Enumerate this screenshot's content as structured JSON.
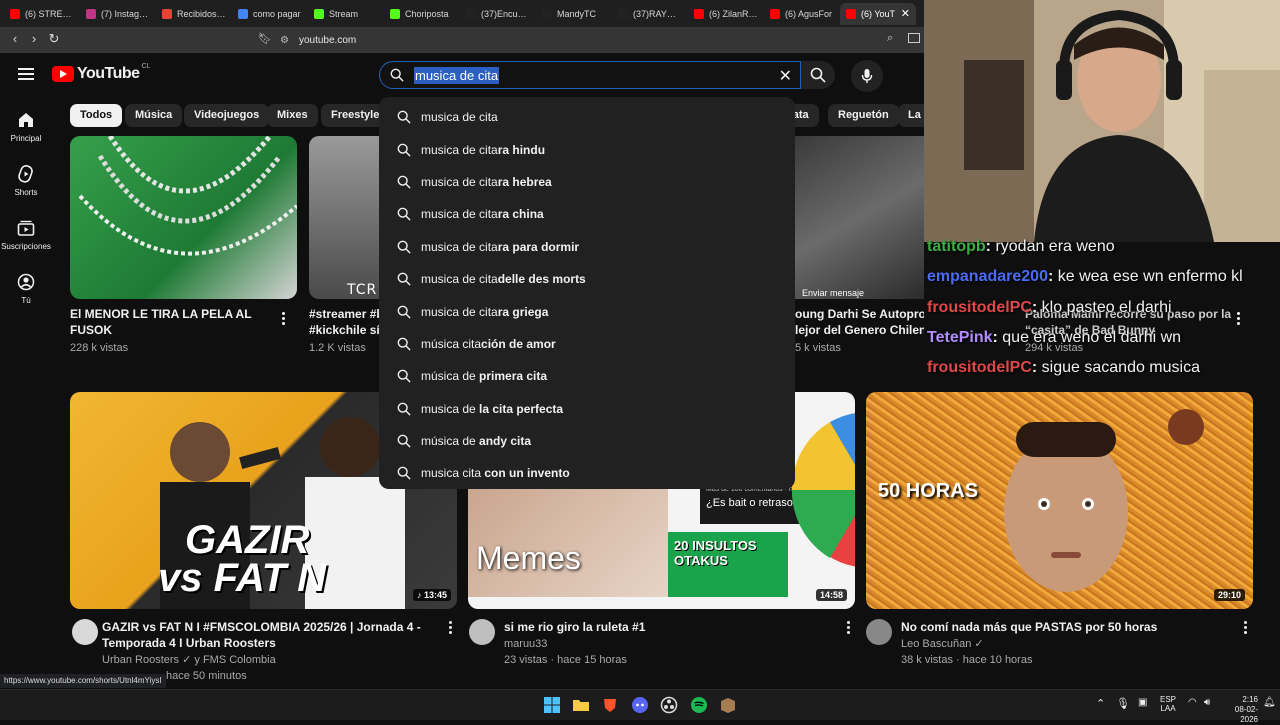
{
  "browser": {
    "tabs": [
      {
        "label": "(6) STREAM",
        "color": "#ff0000"
      },
      {
        "label": "(7) Instagram",
        "color": "#c13584"
      },
      {
        "label": "Recibidos (1",
        "color": "#ea4335"
      },
      {
        "label": "como pagar",
        "color": "#4285f4"
      },
      {
        "label": "Stream",
        "color": "#53fc18"
      },
      {
        "label": "Choriposta",
        "color": "#53fc18"
      },
      {
        "label": "(37)Encuent",
        "color": "#222222"
      },
      {
        "label": "MandyTC",
        "color": "#222222"
      },
      {
        "label": "(37)RAYMAN",
        "color": "#222222"
      },
      {
        "label": "(6) ZilanRap",
        "color": "#ff0000"
      },
      {
        "label": "(6) AgusFor",
        "color": "#ff0000"
      },
      {
        "label": "(6) YouT",
        "color": "#ff0000",
        "active": true
      }
    ],
    "tab_close": "✕",
    "url": "youtube.com"
  },
  "header": {
    "logo_text": "YouTube",
    "country_code": "CL",
    "search_query": "musica de cita"
  },
  "sidebar": {
    "items": [
      {
        "label": "Principal",
        "icon": "home-icon"
      },
      {
        "label": "Shorts",
        "icon": "shorts-icon"
      },
      {
        "label": "Suscripciones",
        "icon": "subscriptions-icon"
      },
      {
        "label": "Tú",
        "icon": "you-icon"
      }
    ]
  },
  "chips": [
    "Todos",
    "Música",
    "Videojuegos",
    "Mixes",
    "Freestyle r",
    "nata",
    "Reguetón",
    "La I"
  ],
  "suggestions": [
    {
      "prefix": "musica de cita",
      "rest": ""
    },
    {
      "prefix": "musica de cita",
      "rest": "ra hindu"
    },
    {
      "prefix": "musica de cita",
      "rest": "ra hebrea"
    },
    {
      "prefix": "musica de cita",
      "rest": "ra china"
    },
    {
      "prefix": "musica de cita",
      "rest": "ra para dormir"
    },
    {
      "prefix": "musica de cita",
      "rest": "delle des morts"
    },
    {
      "prefix": "musica de cita",
      "rest": "ra griega"
    },
    {
      "prefix": "música cita",
      "rest": "ción de amor"
    },
    {
      "prefix": "música de ",
      "rest": "primera cita"
    },
    {
      "prefix": "musica de ",
      "rest": "la cita perfecta"
    },
    {
      "prefix": "música de ",
      "rest": "andy cita"
    },
    {
      "prefix": "musica cita ",
      "rest": "con un invento"
    }
  ],
  "videos_row1": [
    {
      "title_1": "El MENOR LE TIRA LA PELA AL",
      "title_2": "FUSOK",
      "meta": "228 k vistas"
    },
    {
      "title_1": "#streamer #b",
      "title_2": "#kickchile síg",
      "meta": "1.2 K vistas",
      "thumb_text": "TCR"
    },
    {
      "title_1": "oung Darhi Se Autoproclama",
      "title_2": "lejor del Genero Chileno",
      "meta": "5 k vistas",
      "overlay": "Enviar mensaje"
    },
    {
      "title_1": "Paloma Mami recorre su paso por la",
      "title_2": "“casita” de Bad Bunny",
      "meta": "294 k vistas"
    }
  ],
  "videos_row2": [
    {
      "title_1": "GAZIR vs FAT N I #FMSCOLOMBIA 2025/26 | Jornada 4 -",
      "title_2": "Temporada 4 I Urban Roosters",
      "channel": "Urban Roosters",
      "channel_extra": "y FMS Colombia",
      "meta": "hace 50 minutos",
      "duration": "13:45",
      "thumb_line1": "GAZIR",
      "thumb_line2": "vs FAT N"
    },
    {
      "title_1": "si me rio giro la ruleta #1",
      "title_2": "",
      "channel": "maruu33",
      "meta": "23 vistas · hace 15 horas",
      "duration": "14:58",
      "thumb_memes": "Memes",
      "thumb_bubble": "¿Es bait o retraso mental?",
      "thumb_bubble_small": "Más de 100 comentarios · hace 9",
      "thumb_insultos": "20 INSULTOS OTAKUS"
    },
    {
      "title_1": "No comí nada más que PASTAS por 50 horas",
      "title_2": "",
      "channel": "Leo Bascuñan",
      "meta": "38 k vistas · hace 10 horas",
      "duration": "29:10",
      "thumb_text": "50 HORAS"
    }
  ],
  "chat": [
    {
      "user": "tatitopb",
      "msg": "ryodan era weno",
      "color": "#3cb043"
    },
    {
      "user": "empanadare200",
      "msg": "ke wea ese wn enfermo kl",
      "color": "#4a6cf7"
    },
    {
      "user": "frousitodelPC",
      "msg": "klo pasteo el darhi",
      "color": "#e04848"
    },
    {
      "user": "TetePink",
      "msg": "que era weno el darhi wn",
      "color": "#b48cff"
    },
    {
      "user": "frousitodelPC",
      "msg": "sigue sacando musica",
      "color": "#e04848"
    }
  ],
  "status_url": "https://www.youtube.com/shorts/Utnl4mYiysI",
  "taskbar": {
    "lang": "ESP",
    "lang2": "LAA",
    "time": "2:16",
    "date": "08-02-2026"
  },
  "colors": {
    "accent": "#ff0000",
    "search_border": "#1c62b9",
    "selection": "#2b5fc1"
  }
}
